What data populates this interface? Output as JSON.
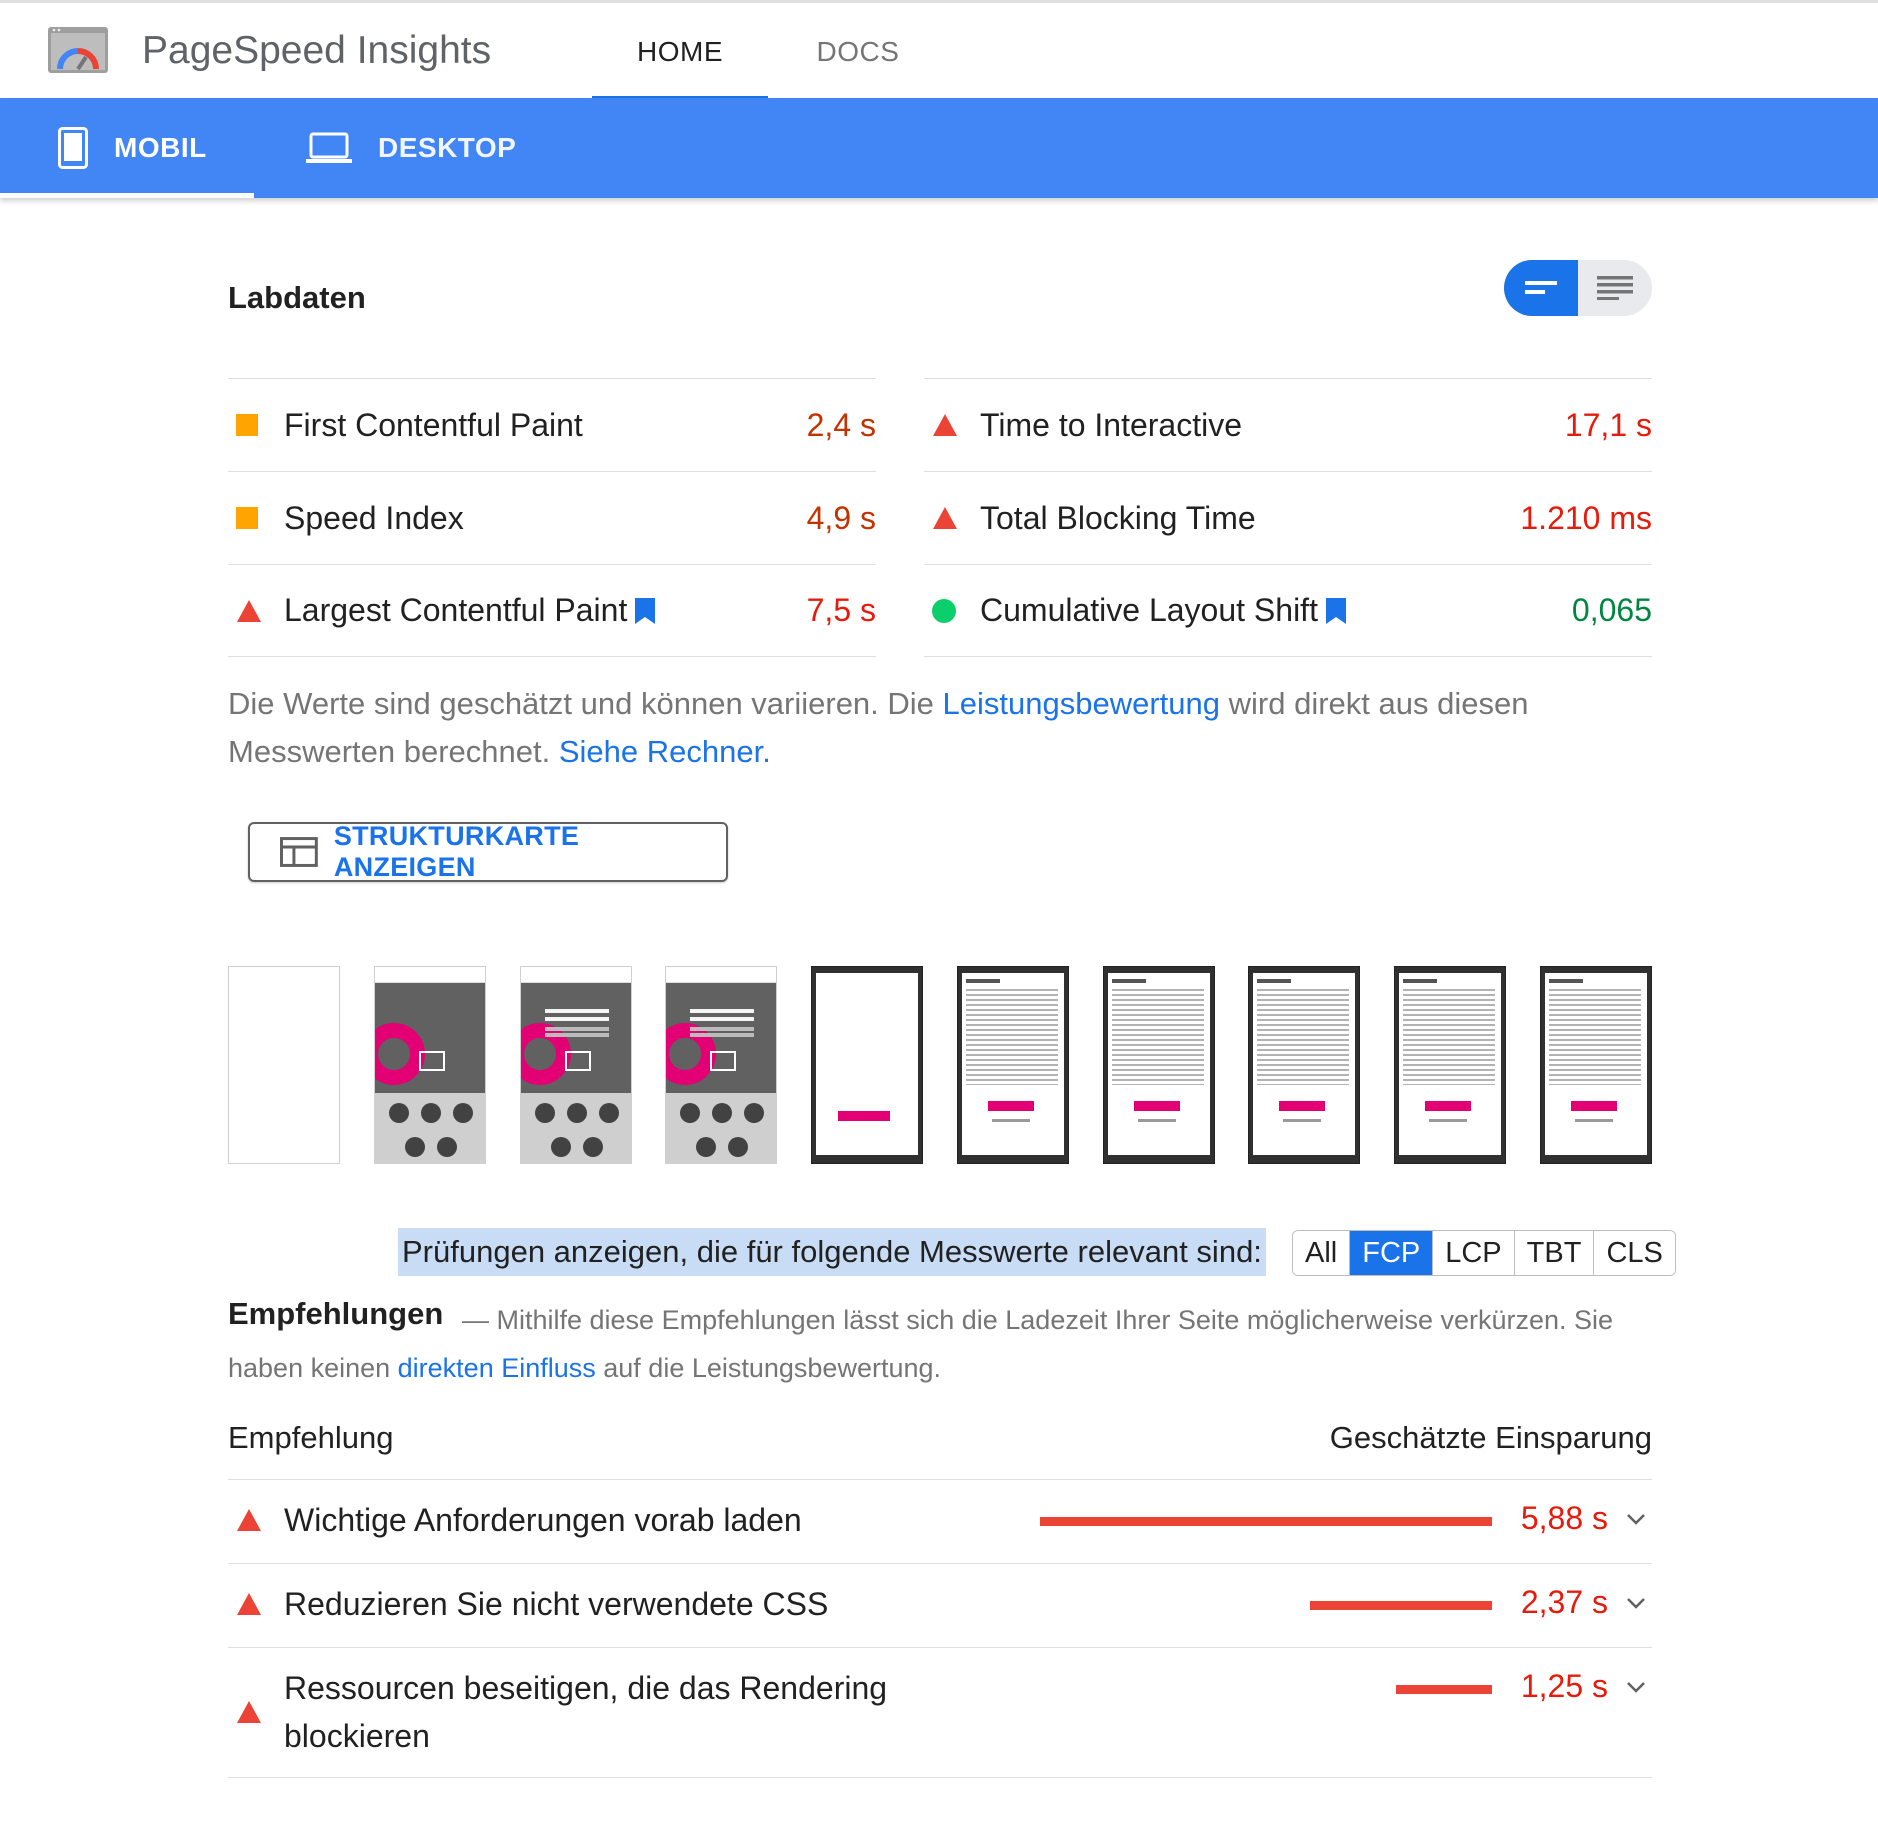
{
  "app": {
    "title": "PageSpeed Insights",
    "nav": [
      {
        "label": "HOME",
        "active": true
      },
      {
        "label": "DOCS",
        "active": false
      }
    ]
  },
  "devices": [
    {
      "label": "MOBIL",
      "active": true,
      "icon": "smartphone-icon"
    },
    {
      "label": "DESKTOP",
      "active": false,
      "icon": "laptop-icon"
    }
  ],
  "lab": {
    "title": "Labdaten",
    "metrics_left": [
      {
        "name": "First Contentful Paint",
        "value": "2,4 s",
        "status": "average"
      },
      {
        "name": "Speed Index",
        "value": "4,9 s",
        "status": "average"
      },
      {
        "name": "Largest Contentful Paint",
        "value": "7,5 s",
        "status": "fail",
        "bookmark": true
      }
    ],
    "metrics_right": [
      {
        "name": "Time to Interactive",
        "value": "17,1 s",
        "status": "fail"
      },
      {
        "name": "Total Blocking Time",
        "value": "1.210 ms",
        "status": "fail"
      },
      {
        "name": "Cumulative Layout Shift",
        "value": "0,065",
        "status": "pass",
        "bookmark": true
      }
    ],
    "note_part1": "Die Werte sind geschätzt und können variieren. Die ",
    "note_link1": "Leistungsbewertung",
    "note_part2": " wird direkt aus diesen Messwerten berechnet. ",
    "note_link2": "Siehe Rechner."
  },
  "treemap_button": "STRUKTURKARTE ANZEIGEN",
  "filter": {
    "label": "Prüfungen anzeigen, die für folgende Messwerte relevant sind:",
    "options": [
      "All",
      "FCP",
      "LCP",
      "TBT",
      "CLS"
    ],
    "active": "FCP"
  },
  "recommendations": {
    "title": "Empfehlungen",
    "desc_part1": "— Mithilfe diese Empfehlungen lässt sich die Ladezeit Ihrer Seite möglicherweise verkürzen. Sie haben keinen ",
    "desc_link": "direkten Einfluss",
    "desc_part2": " auf die Leistungsbewertung.",
    "col_left": "Empfehlung",
    "col_right": "Geschätzte Einsparung",
    "items": [
      {
        "name": "Wichtige Anforderungen vorab laden",
        "saving": "5,88 s",
        "saving_seconds": 5.88
      },
      {
        "name": "Reduzieren Sie nicht verwendete CSS",
        "saving": "2,37 s",
        "saving_seconds": 2.37
      },
      {
        "name": "Ressourcen beseitigen, die das Rendering blockieren",
        "saving": "1,25 s",
        "saving_seconds": 1.25
      }
    ]
  },
  "colors": {
    "primary": "#4285f4",
    "accent": "#1a73e8",
    "fail": "#e61b0c",
    "average": "#ffa400",
    "pass": "#0cce6b"
  }
}
